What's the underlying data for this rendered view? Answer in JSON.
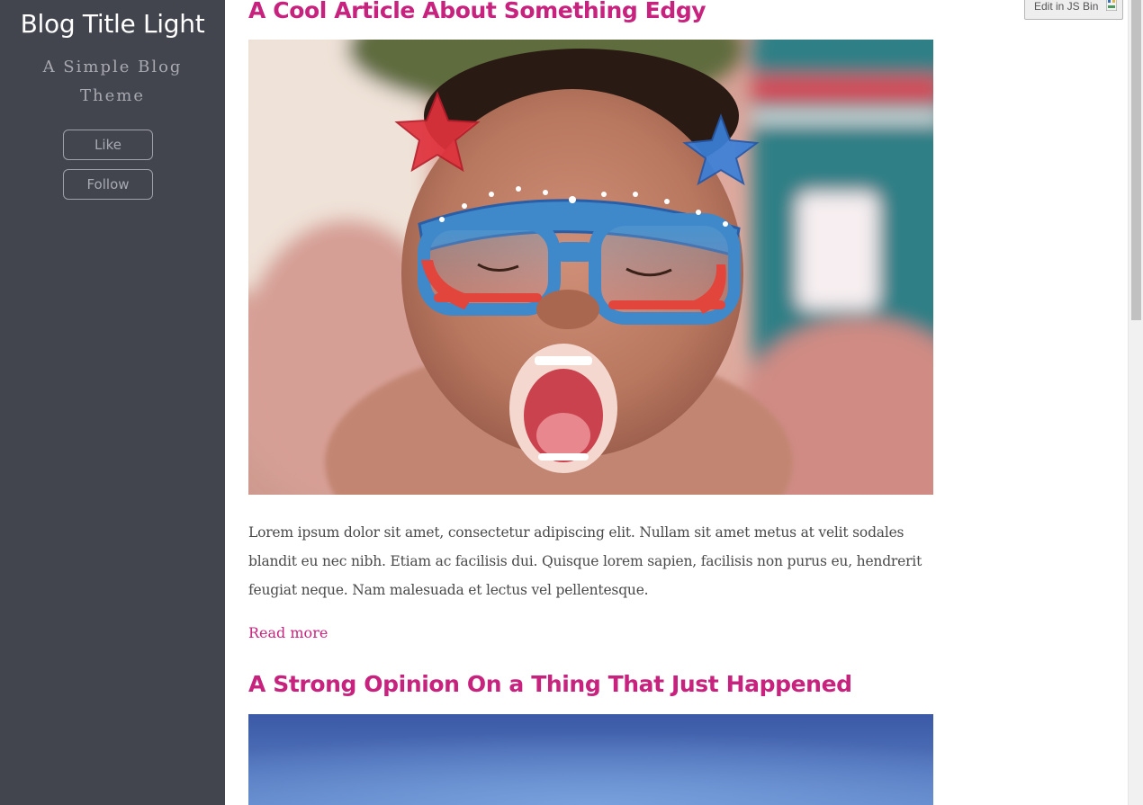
{
  "sidebar": {
    "title": "Blog Title Light",
    "subtitle": "A Simple Blog Theme",
    "like_label": "Like",
    "follow_label": "Follow"
  },
  "posts": [
    {
      "title": "A Cool Article About Something Edgy",
      "excerpt": "Lorem ipsum dolor sit amet, consectetur adipiscing elit. Nullam sit amet metus at velit sodales blandit eu nec nibh. Etiam ac facilisis dui. Quisque lorem sapien, facilisis non purus eu, hendrerit feugiat neque. Nam malesuada et lectus vel pellentesque.",
      "read_more": "Read more"
    },
    {
      "title": "A Strong Opinion On a Thing That Just Happened"
    }
  ],
  "jsbin": {
    "label": "Edit in JS Bin"
  },
  "colors": {
    "sidebar_bg": "#42444e",
    "accent": "#c7237e",
    "body_text": "#4a4a4a",
    "muted": "#a8a9b0"
  }
}
